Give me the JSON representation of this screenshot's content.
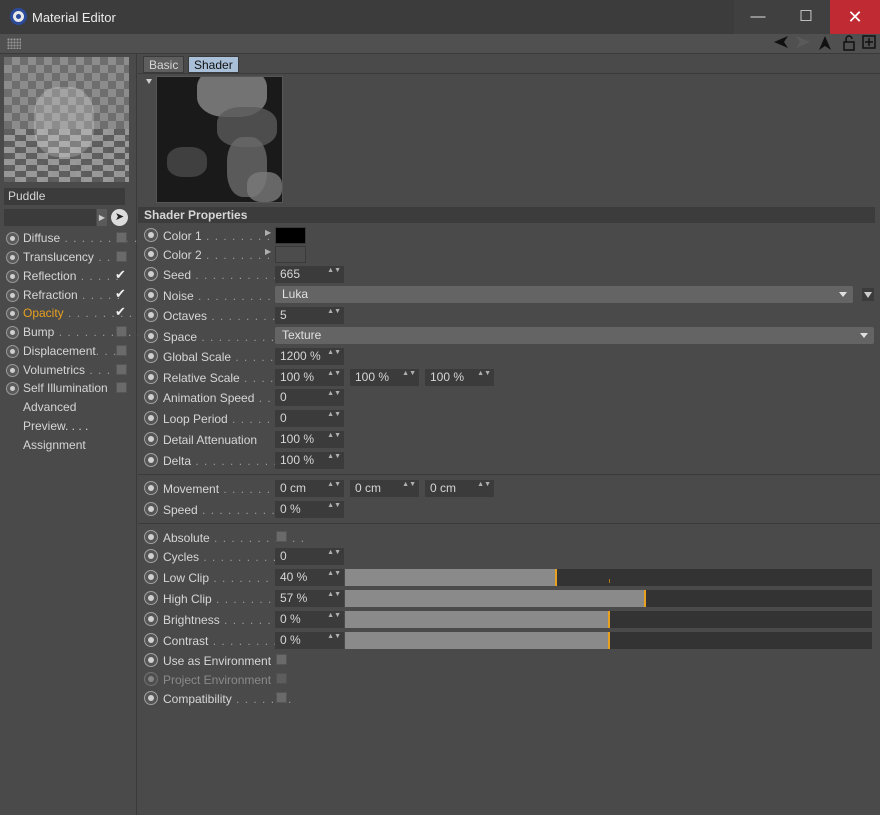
{
  "window": {
    "title": "Material Editor",
    "minimize": "—",
    "maximize": "☐",
    "close": "✕"
  },
  "toolbar": {
    "icons": [
      "arrow-left-icon",
      "arrow-right-icon",
      "arrow-up-icon",
      "lock-icon",
      "add-window-icon"
    ]
  },
  "sidebar": {
    "material_name": "Puddle",
    "channels": [
      {
        "label": "Diffuse",
        "dots": " . . . . . . . . .",
        "checked": false,
        "active": false
      },
      {
        "label": "Translucency",
        "dots": " . . .",
        "checked": false,
        "active": false
      },
      {
        "label": "Reflection",
        "dots": " . . . . .",
        "checked": true,
        "active": false
      },
      {
        "label": "Refraction",
        "dots": " . . . . .",
        "checked": true,
        "active": false
      },
      {
        "label": "Opacity",
        "dots": " . . . . . . . .",
        "checked": true,
        "active": true
      },
      {
        "label": "Bump",
        "dots": " . . . . . . . . . .",
        "checked": false,
        "active": false
      },
      {
        "label": "Displacement",
        "dots": ". . .",
        "checked": false,
        "active": false
      },
      {
        "label": "Volumetrics",
        "dots": " . . . .",
        "checked": false,
        "active": false
      },
      {
        "label": "Self Illumination",
        "dots": "",
        "checked": false,
        "active": false
      }
    ],
    "nav": [
      "Advanced",
      "Preview. . . .",
      "Assignment"
    ]
  },
  "tabs": {
    "basic": "Basic",
    "shader": "Shader"
  },
  "section_title": "Shader Properties",
  "colors": {
    "accent": "#e8a020",
    "color1": "#000000",
    "color2": "#4a4a4a",
    "tab_active": "#a9c0d8"
  },
  "props": {
    "color1": {
      "label": "Color 1",
      "dots": " . . . . . . . . . ."
    },
    "color2": {
      "label": "Color 2",
      "dots": " . . . . . . . . . ."
    },
    "seed": {
      "label": "Seed",
      "dots": " . . . . . . . . . . . . .",
      "value": "665"
    },
    "noise": {
      "label": "Noise",
      "dots": " . . . . . . . . . . . . .",
      "value": "Luka"
    },
    "octaves": {
      "label": "Octaves",
      "dots": " . . . . . . . . . . .",
      "value": "5"
    },
    "space": {
      "label": "Space",
      "dots": " . . . . . . . . . . . . .",
      "value": "Texture"
    },
    "global_scale": {
      "label": "Global Scale",
      "dots": " . . . . . . .",
      "value": "1200 %"
    },
    "relative_scale": {
      "label": "Relative Scale",
      "dots": " . . . . . .",
      "values": [
        "100 %",
        "100 %",
        "100 %"
      ]
    },
    "animation_speed": {
      "label": "Animation Speed",
      "dots": " . .",
      "value": "0"
    },
    "loop_period": {
      "label": "Loop Period",
      "dots": " . . . . . . . .",
      "value": "0"
    },
    "detail_attenuation": {
      "label": "Detail Attenuation",
      "dots": "",
      "value": "100 %"
    },
    "delta": {
      "label": "Delta",
      "dots": " . . . . . . . . . . . . . .",
      "value": "100 %"
    },
    "movement": {
      "label": "Movement",
      "dots": " . . . . . . . . .",
      "values": [
        "0 cm",
        "0 cm",
        "0 cm"
      ]
    },
    "speed": {
      "label": "Speed",
      "dots": " . . . . . . . . . . . . .",
      "value": "0 %"
    },
    "absolute": {
      "label": "Absolute",
      "dots": " . . . . . . . . . . ."
    },
    "cycles": {
      "label": "Cycles",
      "dots": " . . . . . . . . . . . . .",
      "value": "0"
    },
    "low_clip": {
      "label": "Low Clip",
      "dots": " . . . . . . . . . . .",
      "value": "40 %",
      "level": 0.4
    },
    "high_clip": {
      "label": "High Clip",
      "dots": " . . . . . . . . . . .",
      "value": "57 %",
      "level": 0.57
    },
    "brightness": {
      "label": "Brightness",
      "dots": " . . . . . . . . . .",
      "value": "0 %",
      "level": 0.5
    },
    "contrast": {
      "label": "Contrast",
      "dots": " . . . . . . . . . . . .",
      "value": "0 %",
      "level": 0.5
    },
    "use_env": {
      "label": "Use as Environment"
    },
    "project_env": {
      "label": "Project Environment"
    },
    "compat": {
      "label": "Compatibility",
      "dots": " . . . . . . ."
    }
  },
  "spin_glyph": "▲▼"
}
